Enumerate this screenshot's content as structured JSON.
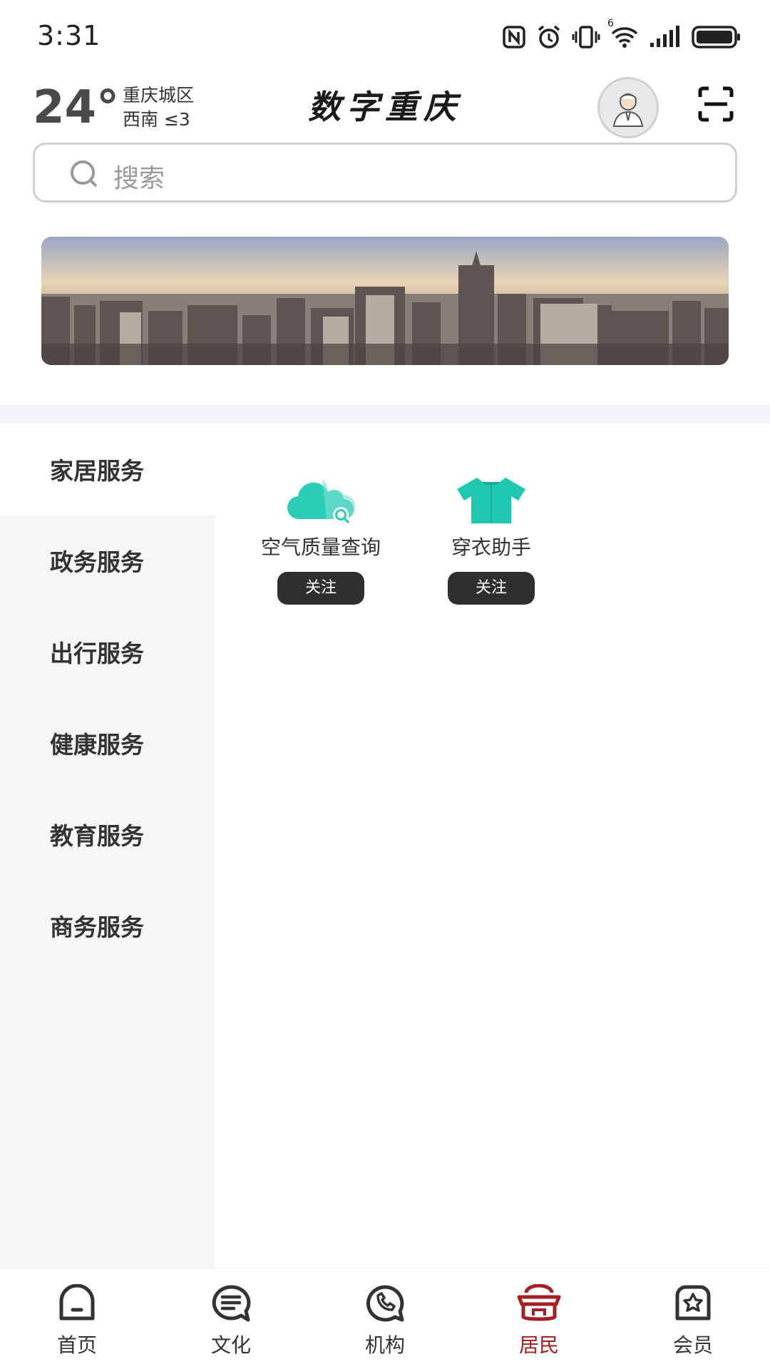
{
  "status_bar": {
    "time": "3:31",
    "icons": [
      "nfc-icon",
      "alarm-icon",
      "vibrate-icon",
      "wifi-icon",
      "signal-icon",
      "battery-icon"
    ],
    "wifi_badge": "6"
  },
  "header": {
    "temperature": "24°",
    "location": "重庆城区",
    "wind": "西南  ≤3",
    "app_title": "数字重庆"
  },
  "search": {
    "placeholder": "搜索"
  },
  "sidebar": {
    "items": [
      {
        "label": "家居服务",
        "active": true
      },
      {
        "label": "政务服务",
        "active": false
      },
      {
        "label": "出行服务",
        "active": false
      },
      {
        "label": "健康服务",
        "active": false
      },
      {
        "label": "教育服务",
        "active": false
      },
      {
        "label": "商务服务",
        "active": false
      }
    ]
  },
  "services": [
    {
      "name": "空气质量查询",
      "icon": "cloud-search-icon",
      "button": "关注"
    },
    {
      "name": "穿衣助手",
      "icon": "tshirt-icon",
      "button": "关注"
    }
  ],
  "bottom_nav": {
    "items": [
      {
        "label": "首页",
        "icon": "home-icon",
        "active": false
      },
      {
        "label": "文化",
        "icon": "culture-icon",
        "active": false
      },
      {
        "label": "机构",
        "icon": "phone-icon",
        "active": false
      },
      {
        "label": "居民",
        "icon": "residents-icon",
        "active": true
      },
      {
        "label": "会员",
        "icon": "member-icon",
        "active": false
      }
    ]
  },
  "colors": {
    "accent": "#a51f24",
    "teal": "#2ccdb7",
    "sidebar_bg": "#f6f6f6",
    "button_bg": "#2f2f2f"
  }
}
